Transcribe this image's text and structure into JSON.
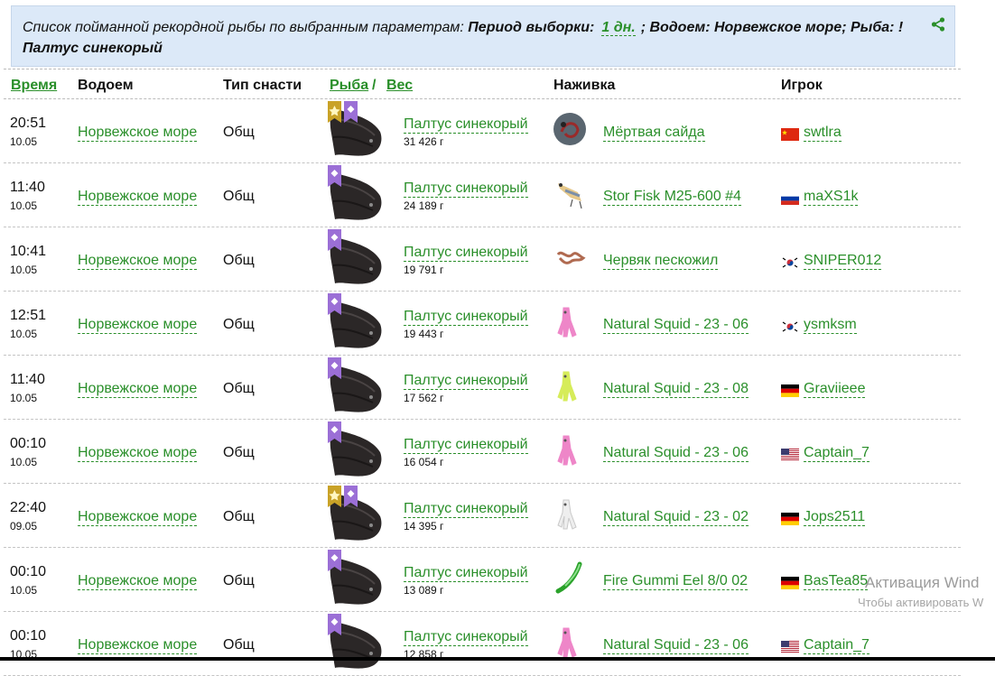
{
  "banner": {
    "intro": "Список пойманной рекордной рыбы по выбранным параметрам:",
    "period_label": "Период выборки:",
    "period_value": "1 дн.",
    "water_text": "; Водоем: Норвежское море; Рыба: !",
    "fish_text": "Палтус синекорый"
  },
  "headers": {
    "time": "Время",
    "water": "Водоем",
    "tackle": "Тип снасти",
    "fish": "Рыба",
    "weight": "Вес",
    "bait": "Наживка",
    "player": "Игрок"
  },
  "rows": [
    {
      "time": "20:51",
      "date": "10.05",
      "water": "Норвежское море",
      "tackle": "Общ",
      "fish": "Палтус синекорый",
      "weight": "31 426 г",
      "bait": "Мёртвая сайда",
      "bait_icon": "dead-fish-bait",
      "player": "swtlra",
      "flag": "china",
      "badges": [
        "gold",
        "purple"
      ]
    },
    {
      "time": "11:40",
      "date": "10.05",
      "water": "Норвежское море",
      "tackle": "Общ",
      "fish": "Палтус синекорый",
      "weight": "24 189 г",
      "bait": "Stor Fisk M25-600 #4",
      "bait_icon": "wobbler-lure",
      "player": "maXS1k",
      "flag": "russia",
      "badges": [
        "purple"
      ]
    },
    {
      "time": "10:41",
      "date": "10.05",
      "water": "Норвежское море",
      "tackle": "Общ",
      "fish": "Палтус синекорый",
      "weight": "19 791 г",
      "bait": "Червяк пескожил",
      "bait_icon": "worm-bait",
      "player": "SNIPER012",
      "flag": "korea",
      "badges": [
        "purple"
      ]
    },
    {
      "time": "12:51",
      "date": "10.05",
      "water": "Норвежское море",
      "tackle": "Общ",
      "fish": "Палтус синекорый",
      "weight": "19 443 г",
      "bait": "Natural Squid - 23 - 06",
      "bait_icon": "pink-squid-lure",
      "player": "ysmksm",
      "flag": "korea",
      "badges": [
        "purple"
      ]
    },
    {
      "time": "11:40",
      "date": "10.05",
      "water": "Норвежское море",
      "tackle": "Общ",
      "fish": "Палтус синекорый",
      "weight": "17 562 г",
      "bait": "Natural Squid - 23 - 08",
      "bait_icon": "yellow-squid-lure",
      "player": "Graviieee",
      "flag": "germany",
      "badges": [
        "purple"
      ]
    },
    {
      "time": "00:10",
      "date": "10.05",
      "water": "Норвежское море",
      "tackle": "Общ",
      "fish": "Палтус синекорый",
      "weight": "16 054 г",
      "bait": "Natural Squid - 23 - 06",
      "bait_icon": "pink-squid-lure",
      "player": "Captain_7",
      "flag": "usa",
      "badges": [
        "purple"
      ]
    },
    {
      "time": "22:40",
      "date": "09.05",
      "water": "Норвежское море",
      "tackle": "Общ",
      "fish": "Палтус синекорый",
      "weight": "14 395 г",
      "bait": "Natural Squid - 23 - 02",
      "bait_icon": "white-squid-lure",
      "player": "Jops2511",
      "flag": "germany",
      "badges": [
        "gold",
        "purple"
      ]
    },
    {
      "time": "00:10",
      "date": "10.05",
      "water": "Норвежское море",
      "tackle": "Общ",
      "fish": "Палтус синекорый",
      "weight": "13 089 г",
      "bait": "Fire Gummi Eel 8/0 02",
      "bait_icon": "green-eel-lure",
      "player": "BasTea85",
      "flag": "germany",
      "badges": [
        "purple"
      ]
    },
    {
      "time": "00:10",
      "date": "10.05",
      "water": "Норвежское море",
      "tackle": "Общ",
      "fish": "Палтус синекорый",
      "weight": "12 858 г",
      "bait": "Natural Squid - 23 - 06",
      "bait_icon": "pink-squid-lure",
      "player": "Captain_7",
      "flag": "usa",
      "badges": [
        "purple"
      ]
    }
  ],
  "watermark": {
    "line1": "Активация Wind",
    "line2": "Чтобы активировать W"
  },
  "colors": {
    "link_green": "#2a8f2a",
    "banner_bg": "#dce9f8",
    "badge_gold": "#c9a227",
    "badge_purple": "#9b6fd6"
  }
}
